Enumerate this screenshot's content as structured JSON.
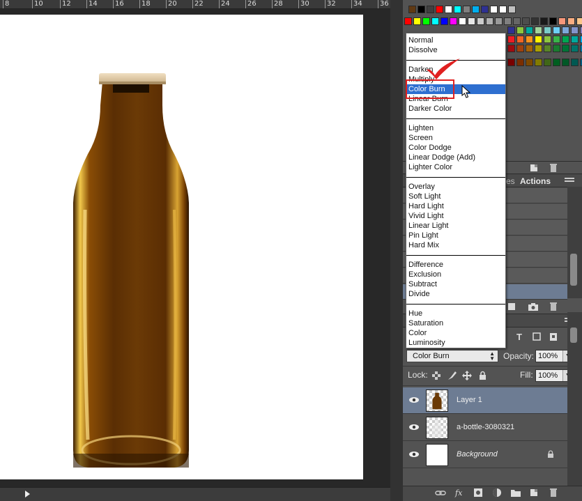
{
  "ruler": {
    "ticks": [
      "8",
      "10",
      "12",
      "14",
      "16",
      "18",
      "20",
      "22",
      "24",
      "26",
      "28",
      "30",
      "32",
      "34",
      "36"
    ]
  },
  "swatches": {
    "row1": [
      "#603913",
      "#000000",
      "#404040",
      "#ff0000",
      "#ffffff",
      "#00ffff",
      "#808080",
      "#00aeef",
      "#2e3192",
      "#ffffff",
      "#ffffff",
      "#c0c0c0"
    ],
    "row2": [
      "#ff0000",
      "#ffff00",
      "#00ff00",
      "#00ffff",
      "#0000ff",
      "#ff00ff",
      "#ffffff",
      "#e6e6e6",
      "#cccccc",
      "#b3b3b3",
      "#999999",
      "#808080",
      "#666666",
      "#4d4d4d",
      "#333333",
      "#1a1a1a",
      "#000000",
      "#f7977a",
      "#f9ad81",
      "#fdc68a",
      "#fff79a",
      "#c4df9b"
    ],
    "row3": [
      "#2e3192",
      "#8dc63f",
      "#00a99d",
      "#a3d39c",
      "#7accc8",
      "#6dcff6",
      "#7da7d9",
      "#8393ca",
      "#8781bd",
      "#a187be",
      "#bd8cbf",
      "#f49ac2",
      "#f6989d"
    ],
    "row4": [
      "#ed1c24",
      "#f26522",
      "#f7941d",
      "#fff200",
      "#8dc63f",
      "#39b54a",
      "#00a651",
      "#00a99d",
      "#00aeef",
      "#0072bc",
      "#0054a6",
      "#2e3192",
      "#662d91",
      "#92278f",
      "#ec008c",
      "#ed145b"
    ],
    "row5": [
      "#9e0b0f",
      "#a0410d",
      "#a36209",
      "#aba000",
      "#598527",
      "#1a7b30",
      "#007236",
      "#00746b",
      "#0076a3",
      "#004b80",
      "#003471",
      "#1b1464",
      "#440e62",
      "#630460",
      "#9e005d",
      "#9e0039"
    ],
    "row6": [
      "#790000",
      "#7b2e00",
      "#7d4900",
      "#827b00",
      "#406618",
      "#005e20",
      "#005826",
      "#005952",
      "#005b7f",
      "#003663",
      "#002157",
      "#0d004c",
      "#32004b",
      "#4b0049",
      "#7b0046",
      "#7a0026",
      "#c7b299",
      "#998675"
    ]
  },
  "panel_tabs": {
    "history_partial": "es",
    "actions": "Actions"
  },
  "blend_modes": {
    "group1": [
      "Normal",
      "Dissolve"
    ],
    "group2": [
      "Darken",
      "Multiply",
      "Color Burn",
      "Linear Burn",
      "Darker Color"
    ],
    "group3": [
      "Lighten",
      "Screen",
      "Color Dodge",
      "Linear Dodge (Add)",
      "Lighter Color"
    ],
    "group4": [
      "Overlay",
      "Soft Light",
      "Hard Light",
      "Vivid Light",
      "Linear Light",
      "Pin Light",
      "Hard Mix"
    ],
    "group5": [
      "Difference",
      "Exclusion",
      "Subtract",
      "Divide"
    ],
    "group6": [
      "Hue",
      "Saturation",
      "Color",
      "Luminosity"
    ],
    "selected": "Color Burn"
  },
  "layers_panel": {
    "blend_mode_value": "Color Burn",
    "opacity_label": "Opacity:",
    "opacity_value": "100%",
    "lock_label": "Lock:",
    "fill_label": "Fill:",
    "fill_value": "100%",
    "layers": [
      {
        "name": "Layer 1",
        "selected": true,
        "italic": false
      },
      {
        "name": "a-bottle-3080321",
        "selected": false,
        "italic": false
      },
      {
        "name": "Background",
        "selected": false,
        "italic": true,
        "locked": true
      }
    ]
  },
  "colors": {
    "selection_blue": "#2e6fd0",
    "layer_selected": "#6d7c93",
    "annotation_red": "#e02020"
  }
}
